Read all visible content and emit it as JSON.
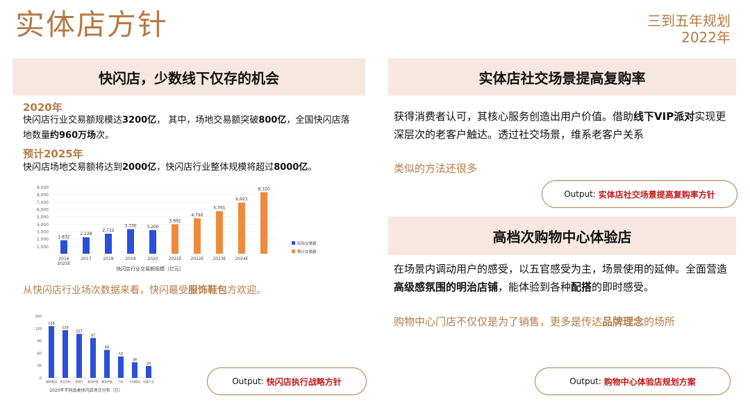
{
  "header": {
    "title": "实体店方针",
    "plan_line1": "三到五年规划",
    "plan_line2": "2022年"
  },
  "left": {
    "band_title": "快闪店，少数线下仅存的机会",
    "year2020": "2020年",
    "p2020": {
      "a": "快闪店行业交易额规模达",
      "b": "3200亿",
      "c": "，   其中，场地交易额突破",
      "d": "800亿",
      "e": "，全国快闪店落地数量",
      "f": "约960万场",
      "g": "次。"
    },
    "year2025": "预计2025年",
    "p2025": {
      "a": "快闪店场地交易额将达到",
      "b": "2000亿",
      "c": "，快闪店行业整体规模将超过",
      "d": "8000亿",
      "e": "。"
    },
    "insight": {
      "a": "从快闪店行业场次数据来看，快闪最受",
      "b": "服饰鞋包",
      "c": "方欢迎。"
    },
    "output_label": "Output: ",
    "output_value": "快闪店执行战略方针"
  },
  "right": {
    "band1_title": "实体店社交场景提高复购率",
    "p1": {
      "a": "获得消费者认可，其核心服务创造出用户价值。借助",
      "b": "线下VIP派对",
      "c": "实现更深层次的老客户触达。透过社交场景，维系老客户关系"
    },
    "note1": "类似的方法还很多",
    "output1_label": "Output: ",
    "output1_value": "实体店社交场景提高复购率方针",
    "band2_title": "高档次购物中心体验店",
    "p2": {
      "a": "在场景内调动用户的感受，以五官感受为主，场景使用的延伸。全面营造",
      "b": "高级感氛围的明治店铺",
      "c": "，能体验到各种",
      "d": "配搭",
      "e": "的即时感受。"
    },
    "note2": {
      "a": "购物中心门店不仅仅是为了销售，更多是传达",
      "b": "品牌理念",
      "c": "的场所"
    },
    "output2_label": "Output: ",
    "output2_value": "购物中心体验店规划方案"
  },
  "colors": {
    "accent": "#b57a45",
    "band": "#f6e8e1",
    "actual": "#2b4fd8",
    "forecast": "#ef8a3c",
    "output": "#c0181a"
  },
  "chart_data": [
    {
      "type": "bar",
      "title": "快闪店行业交易额规模（亿元）",
      "categories": [
        "2016\n2025E",
        "2017",
        "2018",
        "2019",
        "2020",
        "2021E",
        "2022E",
        "2023E",
        "2024E",
        "2025E"
      ],
      "tick_top": [
        "2016",
        "2017",
        "2018",
        "2019",
        "2020",
        "2021E",
        "2022E",
        "2023E",
        "2024E",
        ""
      ],
      "tick_bottom": "2025E",
      "values": [
        1832,
        2228,
        2712,
        3330,
        3200,
        3992,
        4792,
        5761,
        6923,
        8320
      ],
      "value_labels": [
        "1,832",
        "2,228",
        "2,712",
        "3,330",
        "3,200",
        "3,992",
        "4,792",
        "5,761",
        "6,923",
        "8,320"
      ],
      "series_types": [
        "actual",
        "actual",
        "actual",
        "actual",
        "actual",
        "forecast",
        "forecast",
        "forecast",
        "forecast",
        "forecast"
      ],
      "legend": [
        "实际交易额",
        "预计交易额"
      ],
      "yticks": [
        "1,000",
        "2,000",
        "3,000",
        "4,000",
        "5,000",
        "6,000",
        "7,000",
        "8,000",
        "9,000"
      ],
      "ylim": [
        0,
        9000
      ],
      "legend_position": "right"
    },
    {
      "type": "bar",
      "title": "2020年不同品类快闪店场次分布（万）",
      "categories": [
        "服饰鞋包",
        "食品饮料",
        "房地产",
        "美妆护肤",
        "美妆护肤",
        "汽车",
        "手机数码",
        "母婴产品"
      ],
      "values": [
        126,
        116,
        107,
        97,
        68,
        52,
        38,
        29
      ],
      "yticks": [
        "0",
        "30",
        "60",
        "90",
        "120",
        "150"
      ],
      "ylim": [
        0,
        150
      ]
    }
  ]
}
